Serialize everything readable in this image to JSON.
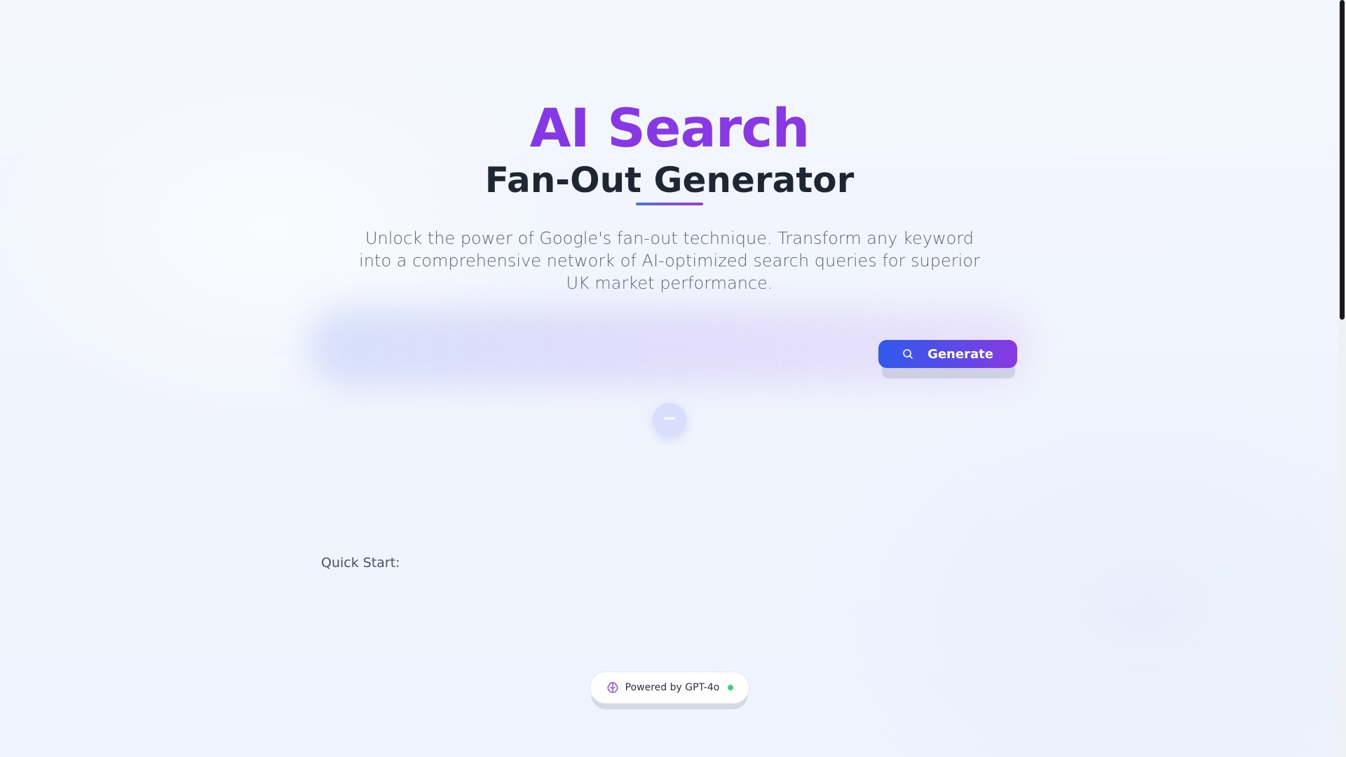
{
  "hero": {
    "title_primary": "AI Search",
    "title_secondary": "Fan-Out Generator",
    "description": "Unlock the power of Google's fan-out technique. Transform any keyword into a comprehensive network of AI-optimized search queries for superior UK market performance."
  },
  "search": {
    "value": "",
    "placeholder": "",
    "button_label": "Generate",
    "button_icon": "search-icon"
  },
  "quick_start": {
    "label": "Quick Start:"
  },
  "footer": {
    "powered_label": "Powered by GPT-4o",
    "icon": "brain-icon",
    "status": "online"
  },
  "colors": {
    "accent_purple": "#8b35e6",
    "accent_blue": "#3159ec",
    "status_green": "#3ed27a",
    "heading_dark": "#1e2633"
  }
}
